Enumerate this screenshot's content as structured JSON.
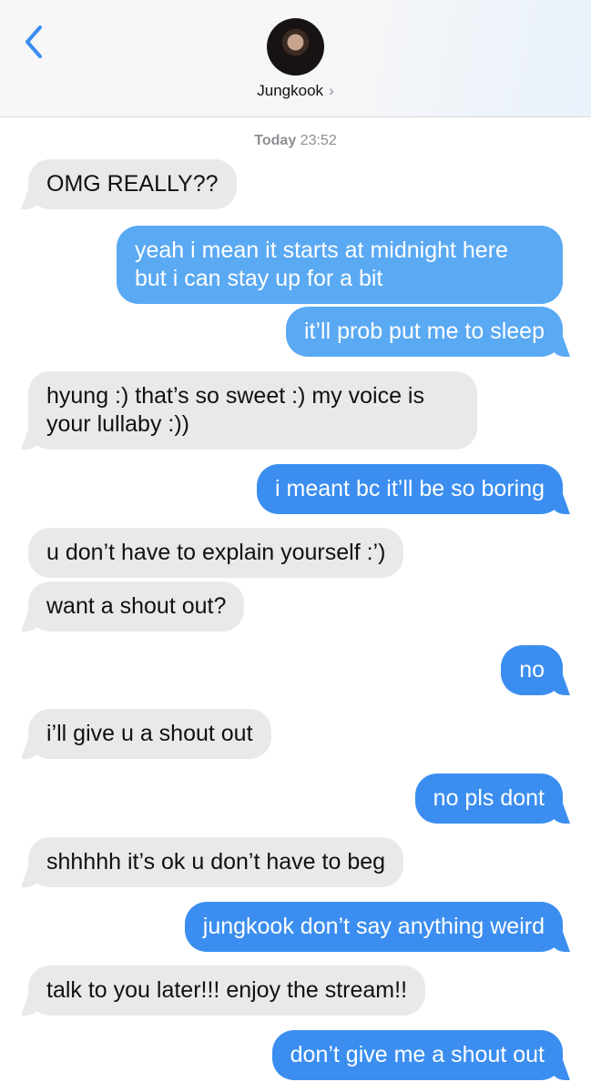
{
  "header": {
    "contact_name": "Jungkook",
    "chevron": "›",
    "back_icon": "chevron-left-icon",
    "accent_color": "#3b8ef0"
  },
  "timestamp": {
    "day": "Today",
    "time": "23:52"
  },
  "messages": [
    {
      "from": "them",
      "text": "OMG REALLY??"
    },
    {
      "from": "me",
      "text": "yeah i mean it starts at midnight here"
    },
    {
      "from": "me",
      "text": "but i can stay up for a bit"
    },
    {
      "from": "me",
      "text": "it’ll prob put me to sleep"
    },
    {
      "from": "them",
      "text": "hyung :) that’s so sweet :) my voice is"
    },
    {
      "from": "them",
      "text": "your lullaby :))"
    },
    {
      "from": "me",
      "text": "i meant bc it’ll be so boring"
    },
    {
      "from": "them",
      "text": "u don’t have to explain yourself :’)"
    },
    {
      "from": "them",
      "text": "want a shout out?"
    },
    {
      "from": "me",
      "text": "no"
    },
    {
      "from": "them",
      "text": "i’ll give u a shout out"
    },
    {
      "from": "me",
      "text": "no pls dont"
    },
    {
      "from": "them",
      "text": "shhhhh it’s ok u don’t have to beg"
    },
    {
      "from": "me",
      "text": "jungkook don’t say anything weird"
    },
    {
      "from": "them",
      "text": "talk to you later!!! enjoy the stream!!"
    },
    {
      "from": "me",
      "text": "don’t give me a shout out"
    }
  ]
}
